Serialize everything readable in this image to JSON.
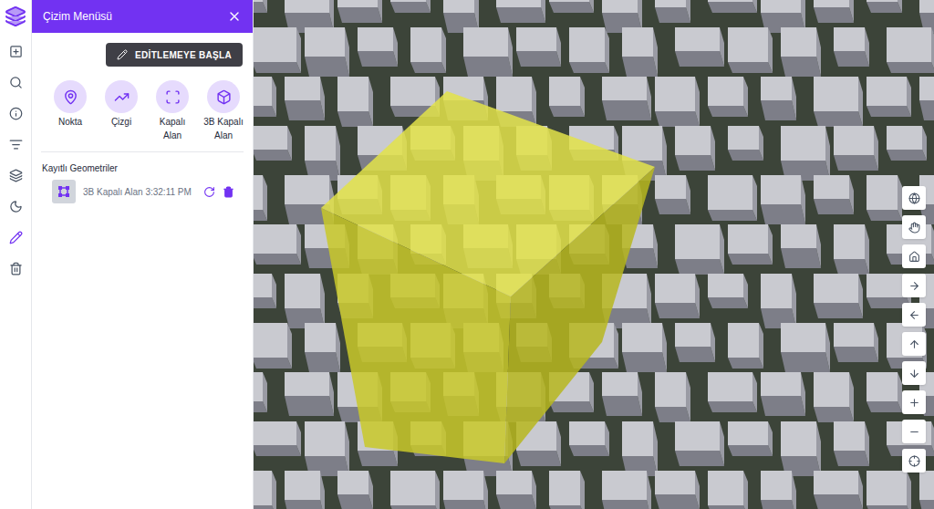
{
  "rail": {
    "items": [
      {
        "selected": false
      },
      {
        "selected": false
      },
      {
        "selected": false
      },
      {
        "selected": false
      },
      {
        "selected": false
      },
      {
        "selected": false
      },
      {
        "selected": true
      },
      {
        "selected": false
      }
    ]
  },
  "panel": {
    "title": "Çizim Menüsü",
    "edit_button": "EDİTLEMEYE BAŞLA",
    "tools": [
      {
        "label": "Nokta"
      },
      {
        "label": "Çizgi"
      },
      {
        "label": "Kapalı\nAlan"
      },
      {
        "label": "3B Kapalı\nAlan"
      }
    ],
    "saved_title": "Kayıtlı Geometriler",
    "saved": [
      {
        "name": "3B Kapalı Alan",
        "time": "3:32:11 PM"
      }
    ]
  }
}
